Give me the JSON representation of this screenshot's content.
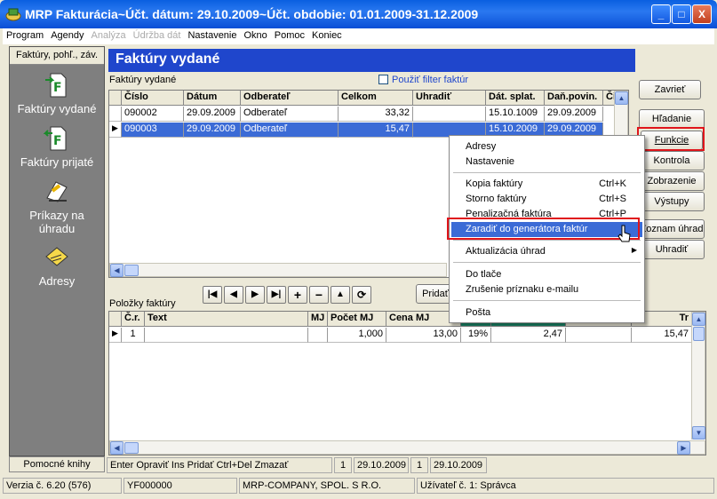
{
  "window": {
    "title": "MRP Fakturácia~Účt. dátum: 29.10.2009~Účt. obdobie: 01.01.2009-31.12.2009",
    "btn_min": "_",
    "btn_max": "□",
    "btn_close": "X"
  },
  "menu": {
    "items": [
      {
        "label": "Program",
        "enabled": true
      },
      {
        "label": "Agendy",
        "enabled": true
      },
      {
        "label": "Analýza",
        "enabled": false
      },
      {
        "label": "Údržba dát",
        "enabled": false
      },
      {
        "label": "Nastavenie",
        "enabled": true
      },
      {
        "label": "Okno",
        "enabled": true
      },
      {
        "label": "Pomoc",
        "enabled": true
      },
      {
        "label": "Koniec",
        "enabled": true
      }
    ]
  },
  "sidebar": {
    "header": "Faktúry, pohľ., záv.",
    "items": [
      {
        "label": "Faktúry vydané"
      },
      {
        "label": "Faktúry prijaté"
      },
      {
        "label": "Príkazy na úhradu"
      },
      {
        "label": "Adresy"
      }
    ],
    "footer": "Pomocné knihy"
  },
  "main": {
    "title": "Faktúry vydané",
    "grid_label": "Faktúry vydané",
    "filter_label": "Použiť filter faktúr",
    "filter_checked": false,
    "columns": [
      "Číslo",
      "Dátum",
      "Odberateľ",
      "Celkom",
      "Uhradiť",
      "Dát. splat.",
      "Daň.povin.",
      "Či"
    ],
    "rows": [
      [
        "090002",
        "29.09.2009",
        "Odberateľ",
        "33,32",
        "",
        "15.10.1009",
        "29.09.2009"
      ],
      [
        "090003",
        "29.09.2009",
        "Odberateľ",
        "15,47",
        "",
        "15.10.2009",
        "29.09.2009"
      ]
    ]
  },
  "buttons": {
    "close": "Zavrieť",
    "search": "Hľadanie",
    "functions": "Funkcie",
    "control": "Kontrola",
    "display": "Zobrazenie",
    "outputs": "Výstupy",
    "payment_list": "Zoznam úhrad",
    "pay": "Uhradiť",
    "add": "Pridať"
  },
  "context_menu": {
    "items": [
      {
        "label": "Adresy",
        "shortcut": ""
      },
      {
        "label": "Nastavenie",
        "shortcut": ""
      },
      {
        "label": "Kopia faktúry",
        "shortcut": "Ctrl+K"
      },
      {
        "label": "Storno faktúry",
        "shortcut": "Ctrl+S"
      },
      {
        "label": "Penalizačná faktúra",
        "shortcut": "Ctrl+P"
      },
      {
        "label": "Zaradiť do generátora faktúr",
        "shortcut": ""
      },
      {
        "label": "Aktualizácia úhrad",
        "shortcut": ""
      },
      {
        "label": "Do tlače",
        "shortcut": ""
      },
      {
        "label": "Zrušenie príznaku e-mailu",
        "shortcut": ""
      },
      {
        "label": "Pošta",
        "shortcut": ""
      }
    ]
  },
  "items_grid": {
    "label": "Položky faktúry",
    "columns": [
      "Č.r.",
      "Text",
      "MJ",
      "Počet MJ",
      "Cena MJ",
      "",
      "",
      "",
      "Tr"
    ],
    "rows": [
      [
        "1",
        "",
        "",
        "1,000",
        "13,00",
        "19%",
        "2,47",
        "",
        "15,47"
      ]
    ]
  },
  "status": {
    "hint": "Enter Opraviť  Ins Pridať  Ctrl+Del Zmazať",
    "c1": "1",
    "c2": "29.10.2009",
    "c3": "1",
    "c4": "29.10.2009"
  },
  "footer": {
    "version": "Verzia č. 6.20 (576)",
    "code": "YF000000",
    "company": "MRP-COMPANY, SPOL. S R.O.",
    "user": "Užívateľ č. 1: Správca"
  },
  "colors": {
    "title_blue": "#1f46cc",
    "selection": "#3b6bd6",
    "highlight_red": "#e0151b"
  }
}
